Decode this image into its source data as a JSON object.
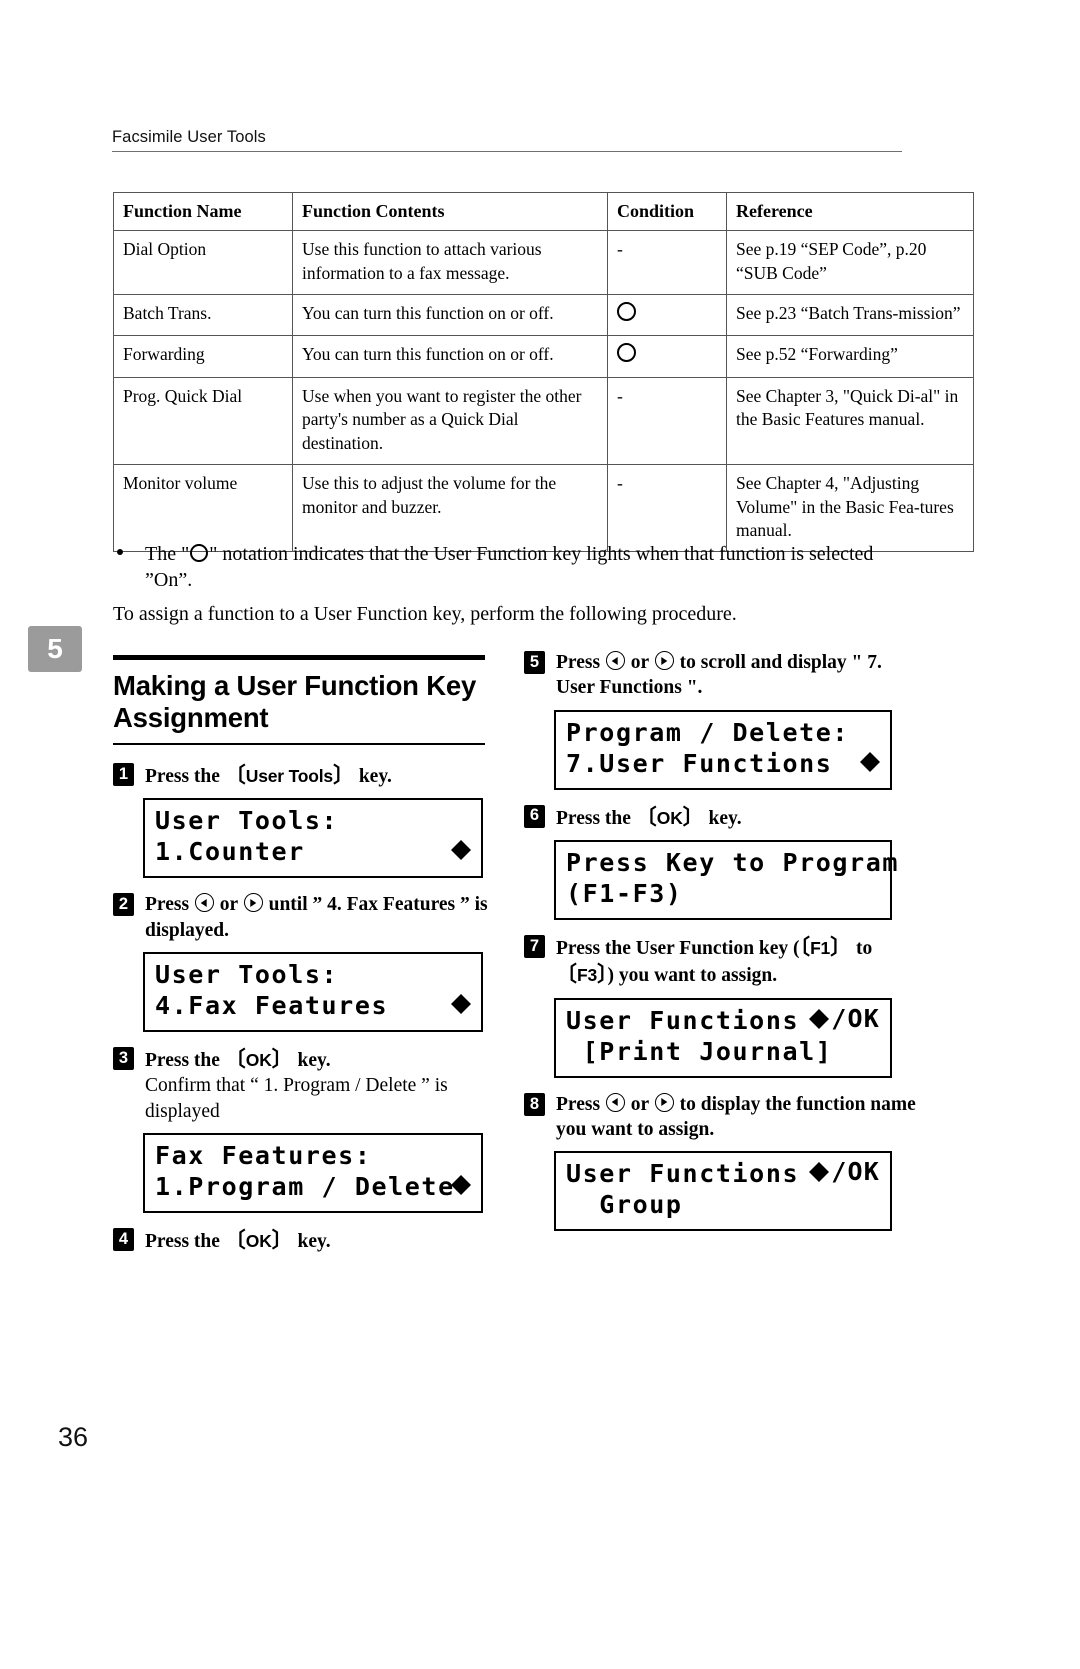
{
  "header": {
    "running_head": "Facsimile User Tools"
  },
  "chapter_tab": {
    "number": "5"
  },
  "table": {
    "headers": [
      "Function Name",
      "Function Contents",
      "Condition",
      "Reference"
    ],
    "rows": [
      {
        "name": "Dial Option",
        "contents": "Use this function to attach various information to a fax message.",
        "condition": "-",
        "condition_type": "dash",
        "reference": "See p.19 “SEP Code”, p.20 “SUB Code”"
      },
      {
        "name": "Batch Trans.",
        "contents": "You can turn this function on or off.",
        "condition": "",
        "condition_type": "circle",
        "reference": "See p.23 “Batch Trans-mission”"
      },
      {
        "name": "Forwarding",
        "contents": "You can turn this function on or off.",
        "condition": "",
        "condition_type": "circle",
        "reference": "See p.52 “Forwarding”"
      },
      {
        "name": "Prog. Quick Dial",
        "contents": "Use when you want to register the other party's number as a Quick Dial destination.",
        "condition": "-",
        "condition_type": "dash",
        "reference": "See Chapter 3, \"Quick Di-al\" in the Basic Features manual."
      },
      {
        "name": "Monitor volume",
        "contents": "Use this to adjust the volume for the monitor and buzzer.",
        "condition": "-",
        "condition_type": "dash",
        "reference": "See Chapter 4, \"Adjusting Volume\" in the Basic Fea-tures manual."
      }
    ]
  },
  "note": {
    "text_before_ring": "The \"",
    "text_after_ring": "\" notation indicates that the User Function key lights when that function is selected ”On”."
  },
  "intro_paragraph": "To assign a function to a User Function key, perform the following procedure.",
  "section": {
    "title": "Making a User Function Key Assignment"
  },
  "steps": [
    {
      "num": "1",
      "head_parts": [
        "Press the ",
        "[User Tools]",
        " key."
      ],
      "body": "",
      "lcd": {
        "line1": "User Tools:",
        "line2": "1.Counter",
        "indicator": "arrows"
      }
    },
    {
      "num": "2",
      "head_parts": [
        "Press ",
        "◀",
        " or ",
        "▶",
        " until ” 4. Fax Features ” is displayed."
      ],
      "body": "",
      "lcd": {
        "line1": "User Tools:",
        "line2": "4.Fax Features",
        "indicator": "arrows"
      }
    },
    {
      "num": "3",
      "head_parts": [
        "Press the ",
        "[OK]",
        " key."
      ],
      "body": "Confirm that “ 1. Program / Delete ” is displayed",
      "lcd": {
        "line1": "Fax Features:",
        "line2": "1.Program / Delete",
        "indicator": "arrows"
      }
    },
    {
      "num": "4",
      "head_parts": [
        "Press the ",
        "[OK]",
        " key."
      ],
      "body": "",
      "lcd": null
    },
    {
      "num": "5",
      "head_parts": [
        "Press ",
        "◀",
        " or ",
        "▶",
        " to scroll and display \" 7. User Functions \"."
      ],
      "body": "",
      "lcd": {
        "line1": "Program / Delete:",
        "line2": "7.User Functions",
        "indicator": "arrows"
      }
    },
    {
      "num": "6",
      "head_parts": [
        "Press the ",
        "[OK]",
        " key."
      ],
      "body": "",
      "lcd": {
        "line1": "Press Key to Program",
        "line2": "(F1-F3)",
        "indicator": "none"
      }
    },
    {
      "num": "7",
      "head_parts": [
        "Press the User Function key (",
        "[F1]",
        " to ",
        "[F3]",
        ") you want to assign."
      ],
      "body": "",
      "lcd": {
        "line1": "User Functions",
        "line2": " [Print Journal]",
        "indicator": "arrows-ok",
        "indicator_ok_label": "/OK"
      }
    },
    {
      "num": "8",
      "head_parts": [
        "Press ",
        "◀",
        " or ",
        "▶",
        " to display the function name you want to assign."
      ],
      "body": "",
      "lcd": {
        "line1": "User Functions",
        "line2": "  Group",
        "indicator": "arrows-ok",
        "indicator_ok_label": "/OK"
      }
    }
  ],
  "folio": {
    "page_number": "36"
  }
}
